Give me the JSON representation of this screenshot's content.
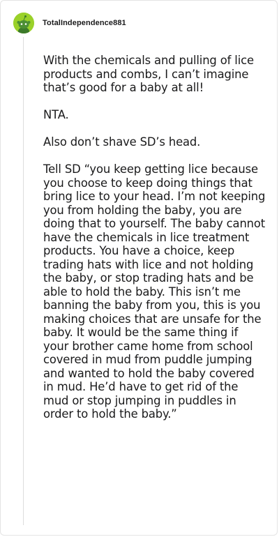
{
  "comment": {
    "username": "TotalIndependence881",
    "avatar": {
      "icon": "snoo-avatar-icon",
      "color": "#9ad12a"
    },
    "paragraphs": [
      "With the chemicals and pulling of lice products and combs, I can’t imagine that’s good for a baby at all!",
      "NTA.",
      "Also don’t shave SD’s head.",
      "Tell SD “you keep getting lice because you choose to keep doing things that bring lice to your head. I’m not keeping you from holding the baby, you are doing that to yourself. The baby cannot have the chemicals in lice treatment products. You have a choice, keep trading hats with lice and not holding the baby, or stop trading hats and be able to hold the baby. This isn’t me banning the baby from you, this is you making choices that are unsafe for the baby. It would be the same thing if your brother came home from school covered in mud from puddle jumping and wanted to hold the baby covered in mud. He’d have to get rid of the mud or stop jumping in puddles in order to hold the baby.”"
    ]
  }
}
